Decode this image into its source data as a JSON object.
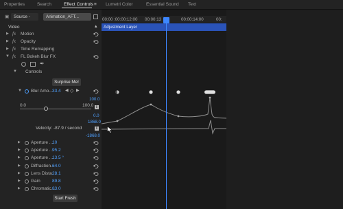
{
  "tabs": {
    "properties": "Properties",
    "search": "Search",
    "effect_controls": "Effect Controls",
    "menu_glyph": "≡",
    "lumetri_color": "Lumetri Color",
    "essential_sound": "Essential Sound",
    "text": "Text"
  },
  "header": {
    "source_label": "Source -",
    "clip_label": "Animation_AFT...",
    "section_video": "Video"
  },
  "effects": {
    "motion": "Motion",
    "opacity": "Opacity",
    "time_remapping": "Time Remapping",
    "bokeh_effect": "FL Bokeh Blur FX",
    "controls": "Controls",
    "fx_glyph": "fx"
  },
  "surprise_button": "Surprise Me!",
  "blur_amount": {
    "label": "Blur Amo...",
    "value": "33.4",
    "graph_max": "100.0",
    "slider_min": "0.0",
    "slider_max": "100.0",
    "slider_fraction": 0.37,
    "graph_zero": "0.0",
    "velocity_top": "1868.0",
    "velocity_text": "Velocity: -87.9 / second",
    "velocity_bottom": "-1868.0"
  },
  "params": [
    {
      "label": "Aperture ...",
      "value": "10"
    },
    {
      "label": "Aperture ...",
      "value": "95.2"
    },
    {
      "label": "Aperture ...",
      "value": "13.5 °"
    },
    {
      "label": "Diffraction...",
      "value": "64.0"
    },
    {
      "label": "Lens Dista...",
      "value": "28.1"
    },
    {
      "label": "Gain",
      "value": "89.8"
    },
    {
      "label": "Chromatic...",
      "value": "83.0"
    }
  ],
  "start_fresh_button": "Start Fresh",
  "timeline": {
    "tick_0": "00:00",
    "tick_1": ":00:00:12:00",
    "tick_2": "00:00:13",
    "tick_3": "00:00:14:00",
    "tick_4": "00:",
    "clip_label": "Adjustment Layer"
  },
  "colors": {
    "accent_blue": "#4ea0ff",
    "clip_bar": "#2a53b8",
    "playhead": "#3d87ff"
  }
}
